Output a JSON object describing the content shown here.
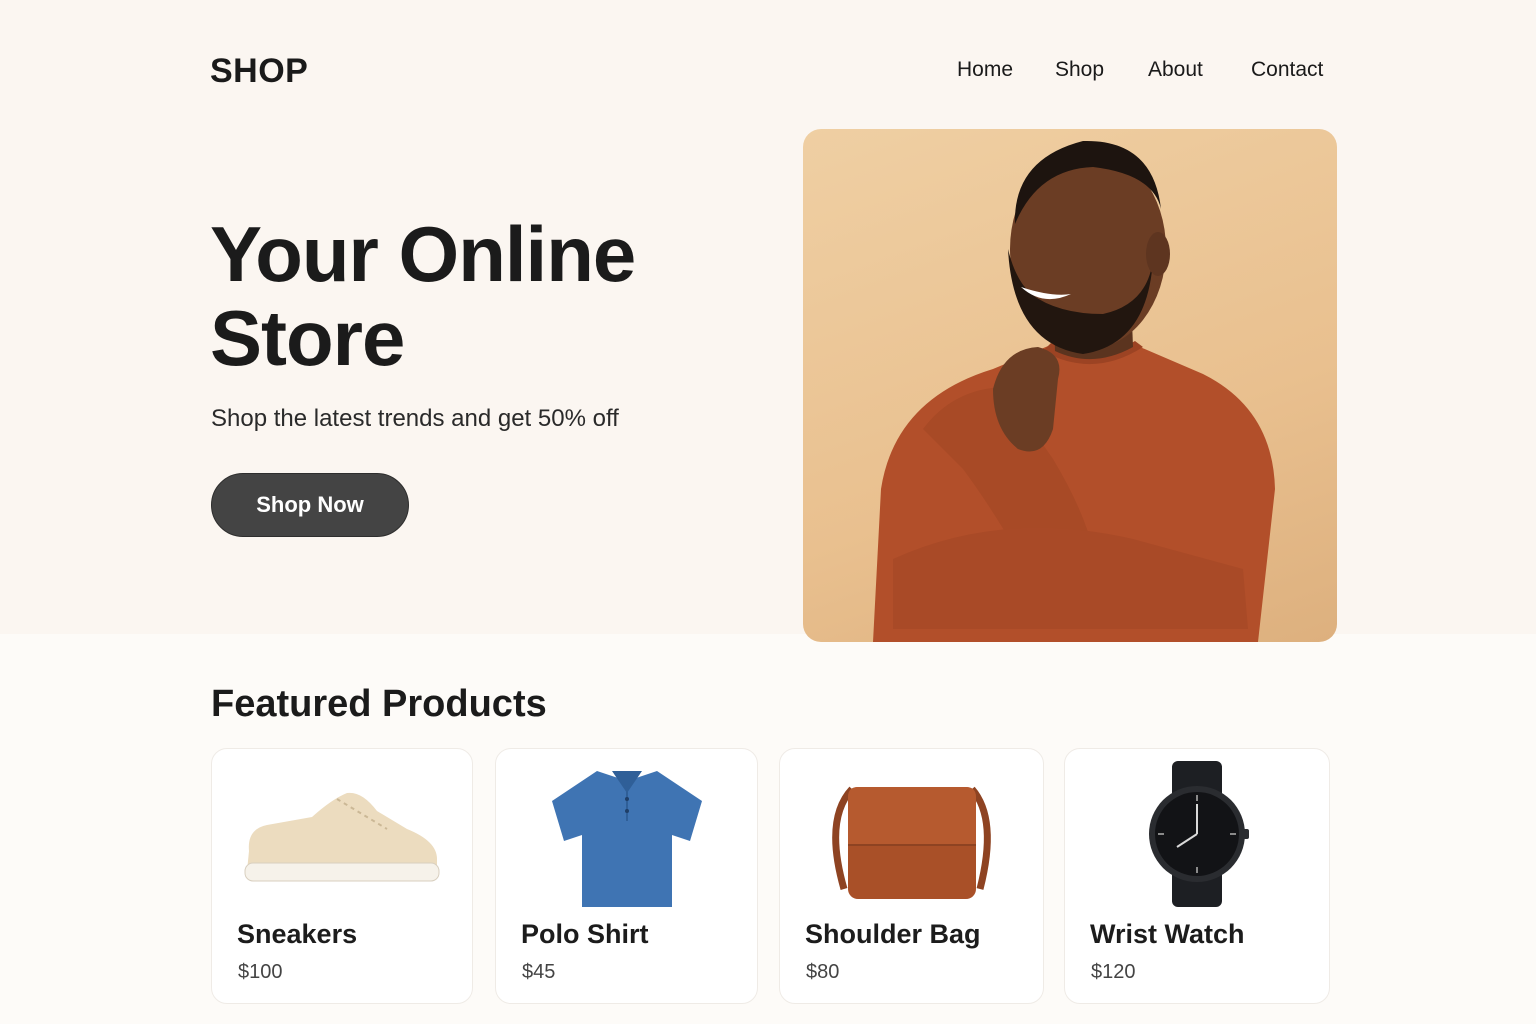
{
  "header": {
    "logo": "SHOP",
    "nav": [
      "Home",
      "Shop",
      "About",
      "Contact"
    ]
  },
  "hero": {
    "title_line1": "Your Online",
    "title_line2": "Store",
    "subtitle": "Shop the latest trends and get 50% off",
    "cta_label": "Shop Now",
    "image": "smiling-man-in-rust-sweater-photo"
  },
  "featured": {
    "title": "Featured Products",
    "products": [
      {
        "name": "Sneakers",
        "price": "$100",
        "image": "sneaker-icon"
      },
      {
        "name": "Polo Shirt",
        "price": "$45",
        "image": "polo-shirt-icon"
      },
      {
        "name": "Shoulder Bag",
        "price": "$80",
        "image": "shoulder-bag-icon"
      },
      {
        "name": "Wrist Watch",
        "price": "$120",
        "image": "wrist-watch-icon"
      }
    ]
  },
  "colors": {
    "hero_background": "#fbf6f1",
    "cta_background": "#444444",
    "photo_background": "#e9c08f",
    "sweater": "#b24f2a"
  }
}
